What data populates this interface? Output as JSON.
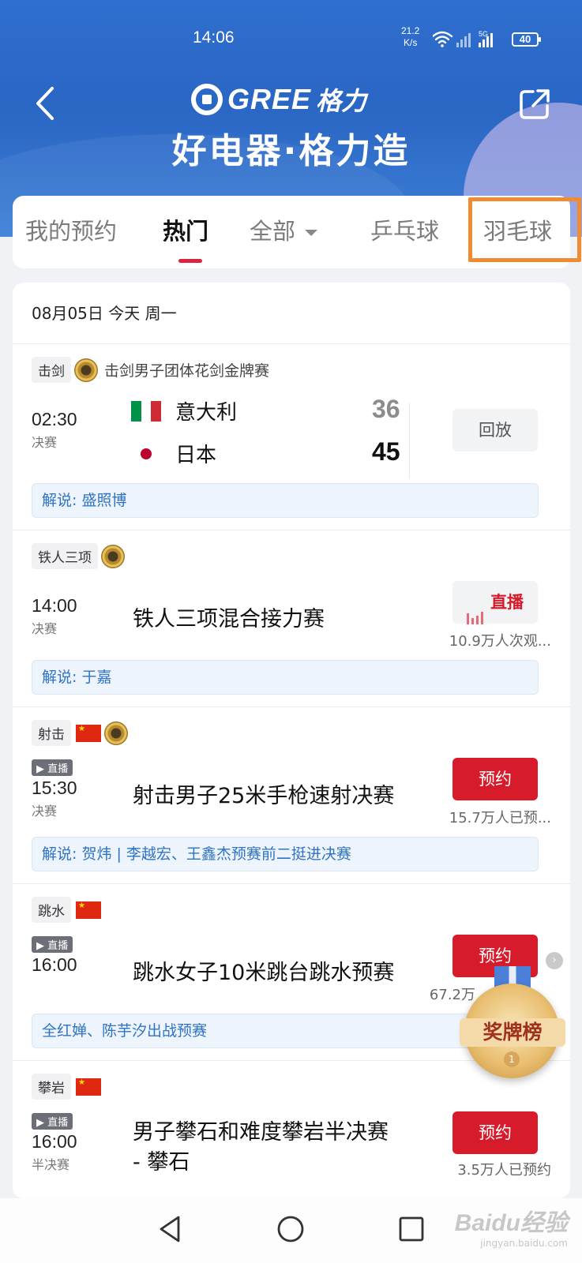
{
  "status_bar": {
    "time": "14:06",
    "net_speed_value": "21.2",
    "net_speed_unit": "K/s",
    "network_label": "5G",
    "battery": "40"
  },
  "header": {
    "brand_word": "GREE",
    "brand_cn": "格力",
    "slogan": "好电器·格力造"
  },
  "tabs": [
    {
      "label": "我的预约",
      "active": false
    },
    {
      "label": "热门",
      "active": true
    },
    {
      "label": "全部",
      "active": false
    },
    {
      "label": "乒乓球",
      "active": false
    },
    {
      "label": "羽毛球",
      "active": false
    }
  ],
  "date_header": "08月05日 今天 周一",
  "matches": [
    {
      "tag": "击剑",
      "title": "击剑男子团体花剑金牌赛",
      "time": "02:30",
      "stage": "决赛",
      "teams": [
        {
          "name": "意大利",
          "score": "36"
        },
        {
          "name": "日本",
          "score": "45"
        }
      ],
      "button": "回放",
      "commentary": "解说: 盛照博"
    },
    {
      "tag": "铁人三项",
      "time": "14:00",
      "stage": "决赛",
      "event": "铁人三项混合接力赛",
      "button": "直播",
      "count": "10.9万人次观...",
      "commentary": "解说: 于嘉"
    },
    {
      "tag": "射击",
      "live_badge": "▶ 直播",
      "time": "15:30",
      "stage": "决赛",
      "event": "射击男子25米手枪速射决赛",
      "button": "预约",
      "count": "15.7万人已预...",
      "commentary": "解说: 贺炜 | 李越宏、王鑫杰预赛前二挺进决赛"
    },
    {
      "tag": "跳水",
      "live_badge": "▶ 直播",
      "time": "16:00",
      "event": "跳水女子10米跳台跳水预赛",
      "button": "预约",
      "count": "67.2万",
      "commentary": "全红婵、陈芋汐出战预赛"
    },
    {
      "tag": "攀岩",
      "live_badge": "▶ 直播",
      "time": "16:00",
      "stage": "半决赛",
      "event_line1": "男子攀石和难度攀岩半决赛",
      "event_line2": "- 攀石",
      "button": "预约",
      "count": "3.5万人已预约"
    }
  ],
  "medal_button": {
    "label": "奖牌榜",
    "rank": "1"
  },
  "watermark": {
    "brand": "Baidu经验",
    "url": "jingyan.baidu.com"
  },
  "colors": {
    "header_blue": "#2f6fcf",
    "accent_red": "#d61c2a",
    "tab_underline": "#d7263d",
    "highlight_orange": "#f08a33",
    "commentary_blue": "#2f73c4"
  }
}
